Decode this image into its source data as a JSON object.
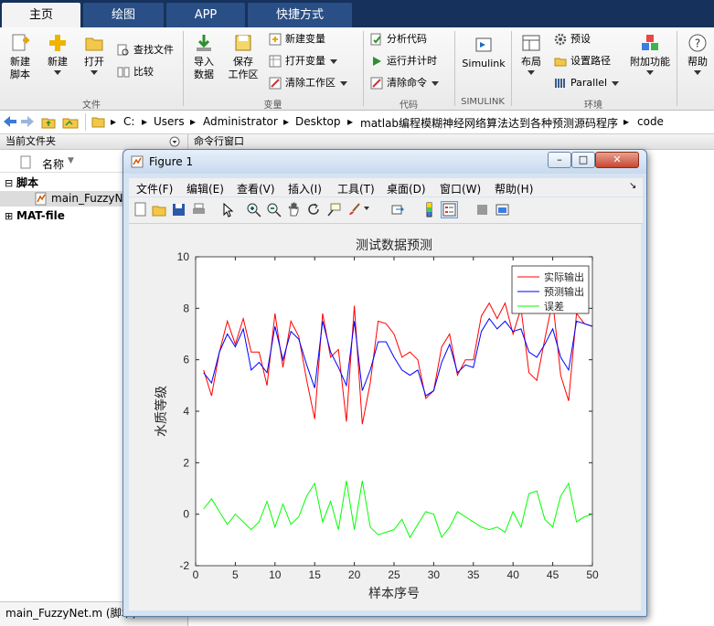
{
  "tabs": [
    {
      "label": "主页",
      "active": true
    },
    {
      "label": "绘图",
      "active": false
    },
    {
      "label": "APP",
      "active": false
    },
    {
      "label": "快捷方式",
      "active": false
    }
  ],
  "ribbon": {
    "new_script": "新建\n脚本",
    "new": "新建",
    "open": "打开",
    "find_files": "查找文件",
    "compare": "比较",
    "import_data": "导入\n数据",
    "save_workspace": "保存\n工作区",
    "new_variable": "新建变量",
    "open_variable": "打开变量",
    "clear_workspace": "清除工作区",
    "analyze_code": "分析代码",
    "run_time": "运行并计时",
    "clear_commands": "清除命令",
    "simulink": "Simulink",
    "layout": "布局",
    "preferences": "预设",
    "set_path": "设置路径",
    "parallel": "Parallel",
    "addons": "附加功能",
    "help": "帮助",
    "groups": {
      "file": "文件",
      "variable": "变量",
      "code": "代码",
      "simulink": "SIMULINK",
      "environment": "环境"
    }
  },
  "address": {
    "parts": [
      "C:",
      "Users",
      "Administrator",
      "Desktop",
      "matlab编程模糊神经网络算法达到各种预测源码程序",
      "code"
    ]
  },
  "left_panel": {
    "title": "当前文件夹",
    "column": "名称",
    "tree": [
      {
        "label": "脚本",
        "expanded": true
      },
      {
        "label": "main_FuzzyNet.m"
      },
      {
        "label": "MAT-file",
        "expanded": false
      }
    ],
    "status": "main_FuzzyNet.m  (脚本)"
  },
  "right_panel": {
    "title": "命令行窗口"
  },
  "figure": {
    "title": "Figure 1",
    "window_buttons": [
      "–",
      "□",
      "✕"
    ],
    "menu": [
      "文件(F)",
      "编辑(E)",
      "查看(V)",
      "插入(I)",
      "工具(T)",
      "桌面(D)",
      "窗口(W)",
      "帮助(H)"
    ],
    "toolbar_icons": [
      "new-figure-icon",
      "open-file-icon",
      "save-icon",
      "print-icon",
      "pointer-icon",
      "zoom-in-icon",
      "zoom-out-icon",
      "pan-icon",
      "rotate-icon",
      "data-cursor-icon",
      "brush-icon",
      "link-icon",
      "colorbar-icon",
      "legend-icon",
      "hide-tools-icon",
      "dock-icon"
    ]
  },
  "chart_data": {
    "type": "line",
    "title": "测试数据预测",
    "xlabel": "样本序号",
    "ylabel": "水质等级",
    "xlim": [
      0,
      50
    ],
    "ylim": [
      -2,
      10
    ],
    "xticks": [
      0,
      5,
      10,
      15,
      20,
      25,
      30,
      35,
      40,
      45,
      50
    ],
    "yticks": [
      -2,
      0,
      2,
      4,
      6,
      8,
      10
    ],
    "grid": false,
    "legend_position": "top-right",
    "x": [
      1,
      2,
      3,
      4,
      5,
      6,
      7,
      8,
      9,
      10,
      11,
      12,
      13,
      14,
      15,
      16,
      17,
      18,
      19,
      20,
      21,
      22,
      23,
      24,
      25,
      26,
      27,
      28,
      29,
      30,
      31,
      32,
      33,
      34,
      35,
      36,
      37,
      38,
      39,
      40,
      41,
      42,
      43,
      44,
      45,
      46,
      47,
      48,
      49,
      50
    ],
    "series": [
      {
        "name": "实际输出",
        "color": "#ff0000",
        "values": [
          5.6,
          4.6,
          6.3,
          7.5,
          6.6,
          7.6,
          6.3,
          6.3,
          5.0,
          7.8,
          5.7,
          7.5,
          6.9,
          5.2,
          3.7,
          7.8,
          6.1,
          6.4,
          3.6,
          8.1,
          3.5,
          5.1,
          7.5,
          7.4,
          7.0,
          6.1,
          6.3,
          6.0,
          4.5,
          4.8,
          6.5,
          7.0,
          5.4,
          6.0,
          6.0,
          7.7,
          8.2,
          7.6,
          8.2,
          7.0,
          8.0,
          5.5,
          5.2,
          6.8,
          8.3,
          5.4,
          4.4,
          7.8,
          7.4,
          7.3
        ]
      },
      {
        "name": "预测输出",
        "color": "#0000ff",
        "values": [
          5.5,
          5.1,
          6.3,
          7.0,
          6.5,
          7.2,
          5.6,
          5.9,
          5.5,
          7.3,
          6.0,
          7.1,
          6.8,
          5.8,
          4.9,
          7.5,
          6.3,
          5.7,
          5.0,
          7.5,
          4.8,
          5.6,
          6.7,
          6.7,
          6.1,
          5.6,
          5.4,
          5.6,
          4.6,
          4.8,
          5.9,
          6.6,
          5.5,
          5.8,
          5.7,
          7.1,
          7.6,
          7.2,
          7.5,
          7.1,
          7.2,
          6.3,
          6.1,
          6.6,
          7.2,
          6.1,
          5.6,
          7.5,
          7.4,
          7.3
        ]
      },
      {
        "name": "误差",
        "color": "#00ff00",
        "values": [
          0.2,
          0.6,
          0.1,
          -0.4,
          0.0,
          -0.3,
          -0.6,
          -0.3,
          0.5,
          -0.5,
          0.4,
          -0.4,
          -0.1,
          0.7,
          1.2,
          -0.3,
          0.5,
          -0.6,
          1.3,
          -0.6,
          1.3,
          -0.5,
          -0.8,
          -0.7,
          -0.6,
          -0.2,
          -0.9,
          -0.4,
          0.1,
          0.0,
          -0.9,
          -0.5,
          0.1,
          -0.1,
          -0.3,
          -0.5,
          -0.6,
          -0.5,
          -0.7,
          0.1,
          -0.5,
          0.8,
          0.9,
          -0.2,
          -0.5,
          0.7,
          1.2,
          -0.3,
          -0.1,
          0.0
        ]
      }
    ]
  }
}
